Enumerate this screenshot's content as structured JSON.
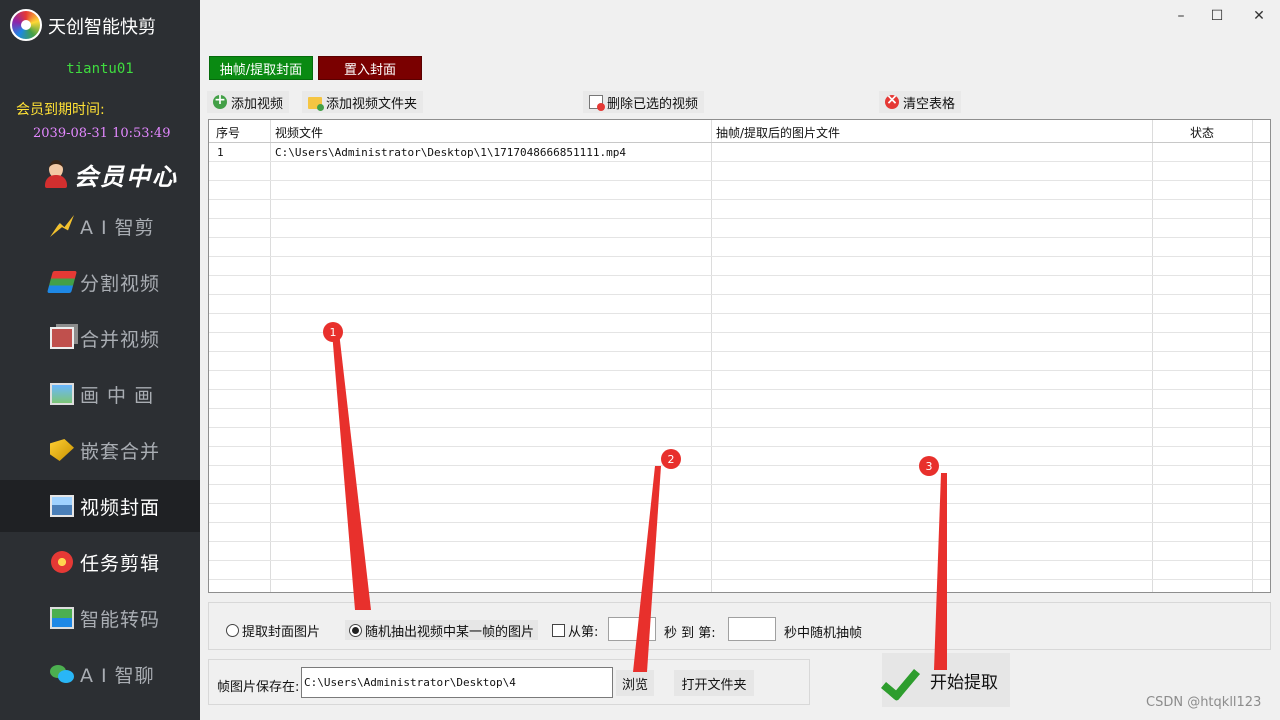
{
  "app": {
    "title": "天创智能快剪",
    "username": "tiantu01",
    "expiry_label": "会员到期时间:",
    "expiry_time": "2039-08-31 10:53:49",
    "member_center": "会员中心"
  },
  "nav": {
    "items": [
      {
        "label": "A I 智剪",
        "icon": "ai-cut-icon"
      },
      {
        "label": "分割视频",
        "icon": "split-video-icon"
      },
      {
        "label": "合并视频",
        "icon": "merge-video-icon"
      },
      {
        "label": "画 中 画",
        "icon": "pip-icon"
      },
      {
        "label": "嵌套合并",
        "icon": "nest-merge-icon"
      },
      {
        "label": "视频封面",
        "icon": "video-cover-icon",
        "active": true
      },
      {
        "label": "任务剪辑",
        "icon": "task-edit-icon"
      },
      {
        "label": "智能转码",
        "icon": "transcode-icon"
      },
      {
        "label": "A I 智聊",
        "icon": "ai-chat-icon"
      }
    ]
  },
  "window": {
    "minimize": "–",
    "maximize": "☐",
    "close": "✕"
  },
  "tabs": {
    "extract": "抽帧/提取封面",
    "insert": "置入封面"
  },
  "toolbar": {
    "add_video": "添加视频",
    "add_folder": "添加视频文件夹",
    "delete_selected": "删除已选的视频",
    "clear_table": "清空表格"
  },
  "table": {
    "columns": [
      "序号",
      "视频文件",
      "抽帧/提取后的图片文件",
      "状态"
    ],
    "rows": [
      {
        "index": "1",
        "file": "C:\\Users\\Administrator\\Desktop\\1\\1717048666851111.mp4",
        "output": "",
        "status": ""
      }
    ]
  },
  "options": {
    "extract_cover": "提取封面图片",
    "random_frame": "随机抽出视频中某一帧的图片",
    "from_label": "从第:",
    "sec_to": "秒 到 第:",
    "sec_random": "秒中随机抽帧",
    "from_value": "",
    "to_value": ""
  },
  "save": {
    "label": "帧图片保存在:",
    "path": "C:\\Users\\Administrator\\Desktop\\4",
    "browse": "浏览",
    "open_folder": "打开文件夹",
    "start": "开始提取"
  },
  "annotations": {
    "markers": [
      "1",
      "2",
      "3"
    ],
    "marker_color": "#e8302c"
  },
  "watermark": "CSDN @htqkll123",
  "colors": {
    "sidebar": "#2c2f33",
    "tab_extract": "#0a8a12",
    "tab_insert": "#7a0000",
    "username": "#3fdc3f",
    "expiry_label": "#ffe135",
    "expiry_time": "#e388ff"
  }
}
